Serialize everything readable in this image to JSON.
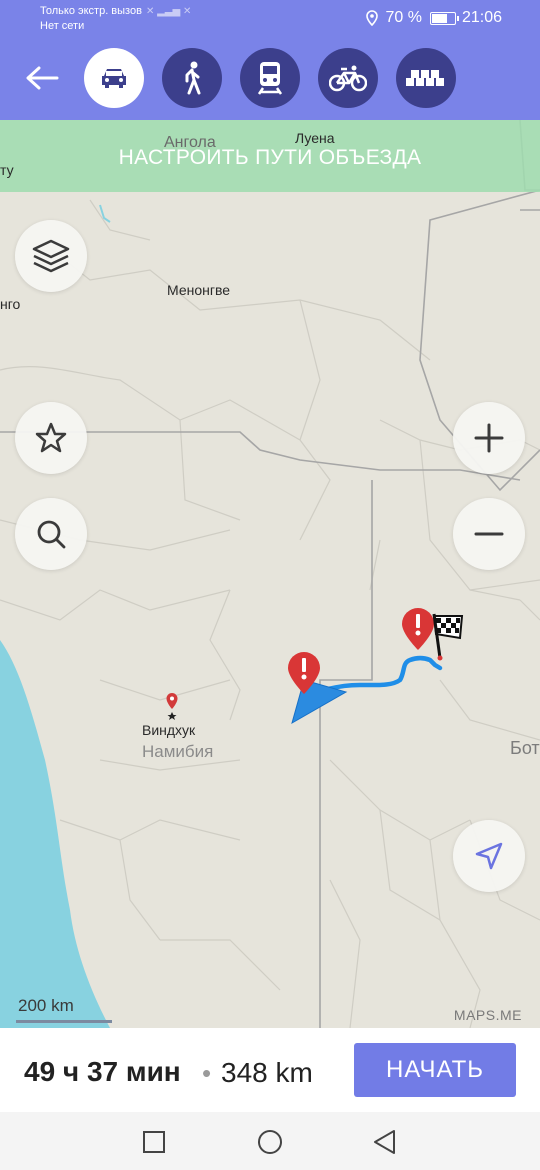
{
  "status_bar": {
    "carrier_line1": "Только экстр. вызов",
    "carrier_line2": "Нет сети",
    "battery_text": "70 %",
    "battery_level": 0.7,
    "time": "21:06",
    "icons": [
      "signal-icon",
      "location-icon",
      "battery-icon"
    ]
  },
  "toolbar": {
    "back_icon": "back-arrow-icon",
    "modes": [
      {
        "id": "car",
        "icon": "car-icon",
        "active": true
      },
      {
        "id": "walk",
        "icon": "pedestrian-icon",
        "active": false
      },
      {
        "id": "transit",
        "icon": "train-icon",
        "active": false
      },
      {
        "id": "bicycle",
        "icon": "bicycle-icon",
        "active": false
      },
      {
        "id": "taxi",
        "icon": "taxi-icon",
        "active": false
      }
    ],
    "accent_color": "#7a83e8",
    "inactive_button_color": "#3c3f8c"
  },
  "map": {
    "detour_banner": "НАСТРОИТЬ ПУТИ ОБЪЕЗДА",
    "labels": {
      "angola": "Ангола",
      "luena": "Луена",
      "edge_left_1": "ту",
      "edge_left_2": "нго",
      "menongue": "Менонгве",
      "windhoek": "Виндхук",
      "namibia": "Намибия",
      "botswana_partial": "Бот"
    },
    "scale_text": "200 km",
    "attribution": "MAPS.ME",
    "route_color": "#1f8ee8",
    "land_color": "#e6e4db",
    "water_color": "#88d2e0"
  },
  "controls": {
    "layers_icon": "layers-icon",
    "bookmarks_icon": "star-icon",
    "search_icon": "search-icon",
    "zoom_in_icon": "plus-icon",
    "zoom_out_icon": "minus-icon",
    "my_location_icon": "navigation-arrow-icon"
  },
  "route": {
    "time": "49 ч 37 мин",
    "separator": "•",
    "distance": "348 km",
    "start_label": "НАЧАТЬ",
    "start_color": "#727ce6"
  },
  "nav_bar": {
    "icons": [
      "recent-apps-icon",
      "home-icon",
      "back-icon"
    ]
  }
}
